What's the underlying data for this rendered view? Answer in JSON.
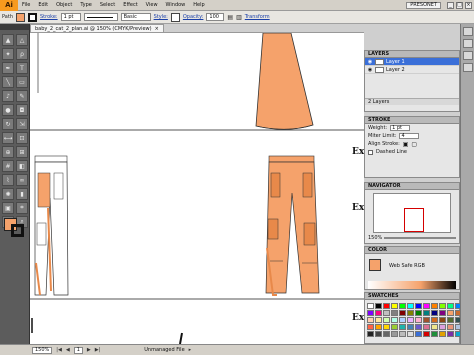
{
  "menubar": {
    "logo": "Ai",
    "items": [
      "File",
      "Edit",
      "Object",
      "Type",
      "Select",
      "Effect",
      "View",
      "Window",
      "Help"
    ],
    "bridge_label": "PRESONET",
    "window_buttons": [
      "_",
      "□",
      "×"
    ]
  },
  "controlbar": {
    "path_label": "Path",
    "fill_color": "#f5a26b",
    "stroke_label": "Stroke:",
    "stroke_value": "1 pt",
    "brush_label": "Basic",
    "style_label": "Style:",
    "opacity_label": "Opacity:",
    "opacity_value": "100",
    "transform_label": "Transform"
  },
  "document": {
    "tab_title": "baby_2_cat_2_plan.ai @ 150% (CMYK/Preview)",
    "tab_close": "×",
    "margin_text": [
      "Ex",
      "Ex",
      "Ex"
    ]
  },
  "layers_panel": {
    "title": "LAYERS",
    "layers": [
      "Layer 1",
      "Layer 2"
    ],
    "footer": "2 Layers"
  },
  "stroke_panel": {
    "title": "STROKE",
    "weight_label": "Weight:",
    "weight_value": "1 pt",
    "miter_label": "Miter Limit:",
    "miter_value": "4",
    "align_label": "Align Stroke:",
    "dashed_label": "Dashed Line"
  },
  "navigator_panel": {
    "title": "NAVIGATOR",
    "zoom": "150%"
  },
  "color_panel": {
    "title": "COLOR",
    "value_label": "Web Safe RGB"
  },
  "swatches_panel": {
    "title": "SWATCHES",
    "colors": [
      "#ffffff",
      "#000000",
      "#ff0000",
      "#ffff00",
      "#00ff00",
      "#00ffff",
      "#0000ff",
      "#ff00ff",
      "#ff8000",
      "#80ff00",
      "#00ff80",
      "#0080ff",
      "#8000ff",
      "#ff0080",
      "#c0c0c0",
      "#808080",
      "#800000",
      "#808000",
      "#008000",
      "#008080",
      "#000080",
      "#800080",
      "#f5a26b",
      "#c86a2e",
      "#ffd0b0",
      "#ffe8a0",
      "#d0ffb0",
      "#b0ffe8",
      "#b0d0ff",
      "#e8b0ff",
      "#ffb0d0",
      "#a0522d",
      "#d2691e",
      "#8b4513",
      "#556b2f",
      "#2f4f4f",
      "#ff6347",
      "#ffa500",
      "#ffd700",
      "#9acd32",
      "#20b2aa",
      "#4682b4",
      "#6a5acd",
      "#db7093",
      "#f0e68c",
      "#dda0dd",
      "#e9967a",
      "#b0c4de",
      "#222222",
      "#444444",
      "#666666",
      "#999999",
      "#bbbbbb",
      "#dddddd",
      "#3a6fd8",
      "#d40000",
      "#1f8f3a",
      "#e0a000",
      "#7a2ea8",
      "#0aa7c9"
    ]
  },
  "statusbar": {
    "zoom": "150%",
    "page": "1",
    "status": "Unmanaged File"
  }
}
